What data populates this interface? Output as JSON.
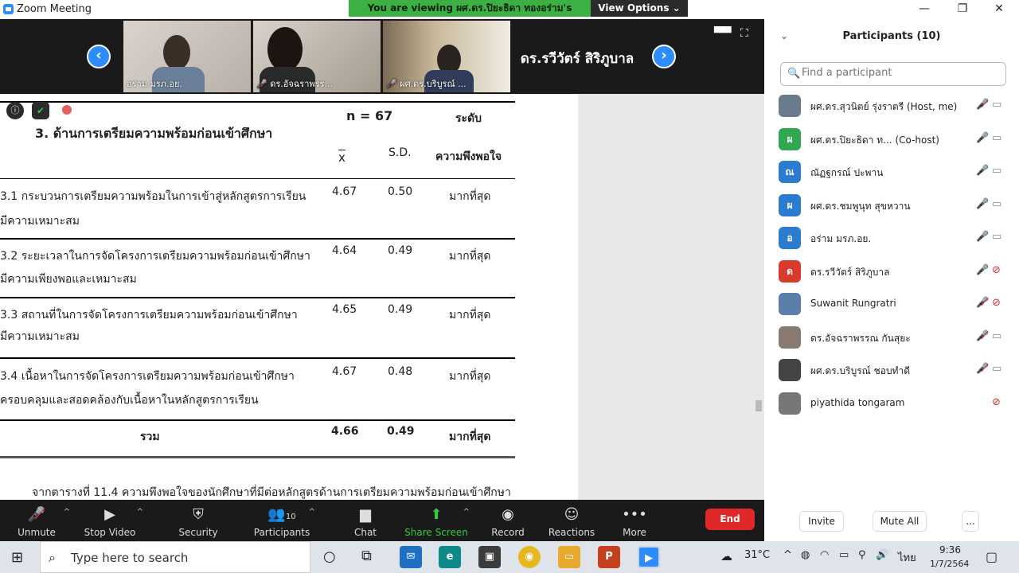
{
  "window": {
    "title": "Zoom Meeting",
    "minimize": "—",
    "restore": "❐",
    "close": "✕"
  },
  "banner": {
    "viewing": "You are viewing ผศ.ดร.ปิยะธิดา ทองอร่าม's screen",
    "view_options": "View Options ⌄"
  },
  "video_strip": {
    "prev": "‹",
    "next": "›",
    "tiles": [
      {
        "name": "อร่าม มรภ.อย."
      },
      {
        "name": "ดร.อัจฉราพรร..."
      },
      {
        "name": "ผศ.ดร.บริบูรณ์ ..."
      }
    ],
    "active_name": "ดร.รวีวัตร์ สิริภูบาล"
  },
  "document": {
    "section_title": "3. ด้านการเตรียมความพร้อมก่อนเข้าศึกษา",
    "header_n": "n = 67",
    "header_level": "ระดับ",
    "header_x": "x",
    "header_sd": "S.D.",
    "header_satisfaction": "ความพึงพอใจ",
    "rows": [
      {
        "line1": "3.1 กระบวนการเตรียมความพร้อมในการเข้าสู่หลักสูตรการเรียน",
        "line2": "มีความเหมาะสม",
        "x": "4.67",
        "sd": "0.50",
        "level": "มากที่สุด"
      },
      {
        "line1": "3.2 ระยะเวลาในการจัดโครงการเตรียมความพร้อมก่อนเข้าศึกษา",
        "line2": "มีความเพียงพอและเหมาะสม",
        "x": "4.64",
        "sd": "0.49",
        "level": "มากที่สุด"
      },
      {
        "line1": "3.3 สถานที่ในการจัดโครงการเตรียมความพร้อมก่อนเข้าศึกษา",
        "line2": "มีความเหมาะสม",
        "x": "4.65",
        "sd": "0.49",
        "level": "มากที่สุด"
      },
      {
        "line1": "3.4 เนื้อหาในการจัดโครงการเตรียมความพร้อมก่อนเข้าศึกษา",
        "line2": "ครอบคลุมและสอดคล้องกับเนื้อหาในหลักสูตรการเรียน",
        "x": "4.67",
        "sd": "0.48",
        "level": "มากที่สุด"
      }
    ],
    "total": {
      "label": "รวม",
      "x": "4.66",
      "sd": "0.49",
      "level": "มากที่สุด"
    },
    "footer_text": "จากตารางที่ 11.4 ความพึงพอใจของนักศึกษาที่มีต่อหลักสูตรด้านการเตรียมความพร้อมก่อนเข้าศึกษา"
  },
  "toolbar": {
    "unmute": "Unmute",
    "stop_video": "Stop Video",
    "security": "Security",
    "participants": "Participants",
    "participants_count": "10",
    "chat": "Chat",
    "share_screen": "Share Screen",
    "record": "Record",
    "reactions": "Reactions",
    "more": "More",
    "end": "End"
  },
  "panel": {
    "title": "Participants (10)",
    "search_placeholder": "Find a participant",
    "participants": [
      {
        "name": "ผศ.ดร.สุวนิตย์ รุ่งราตรี (Host, me)",
        "initial": "",
        "color": "#6a7b8c",
        "mic": "off",
        "cam": "on"
      },
      {
        "name": "ผศ.ดร.ปิยะธิดา ท...  (Co-host)",
        "initial": "ผ",
        "color": "#2fa84f",
        "mic": "on",
        "cam": "on"
      },
      {
        "name": "ณัฏฐกรณ์ ปะพาน",
        "initial": "ณ",
        "color": "#2b7bd1",
        "mic": "on",
        "cam": "on"
      },
      {
        "name": "ผศ.ดร.ชมพูนุท  สุขหวาน",
        "initial": "ผ",
        "color": "#2b7bd1",
        "mic": "on",
        "cam": "on"
      },
      {
        "name": "อร่าม มรภ.อย.",
        "initial": "อ",
        "color": "#2b7bd1",
        "mic": "on",
        "cam": "on"
      },
      {
        "name": "ดร.รวีวัตร์ สิริภูบาล",
        "initial": "ด",
        "color": "#d83b2d",
        "mic": "on",
        "cam": "off"
      },
      {
        "name": "Suwanit Rungratri",
        "initial": "",
        "color": "#5a7fa8",
        "mic": "off",
        "cam": "off"
      },
      {
        "name": "ดร.อัจฉราพรรณ กันสุยะ",
        "initial": "",
        "color": "#8a7a70",
        "mic": "off",
        "cam": "on"
      },
      {
        "name": "ผศ.ดร.บริบูรณ์ ชอบทำดี",
        "initial": "",
        "color": "#444",
        "mic": "off",
        "cam": "on"
      },
      {
        "name": "piyathida tongaram",
        "initial": "",
        "color": "#777",
        "mic": "",
        "cam": "off"
      }
    ],
    "invite": "Invite",
    "mute_all": "Mute All",
    "more": "..."
  },
  "taskbar": {
    "search_placeholder": "Type here to search",
    "temperature": "31°C",
    "lang": "ไทย",
    "time": "9:36",
    "date": "1/7/2564"
  }
}
